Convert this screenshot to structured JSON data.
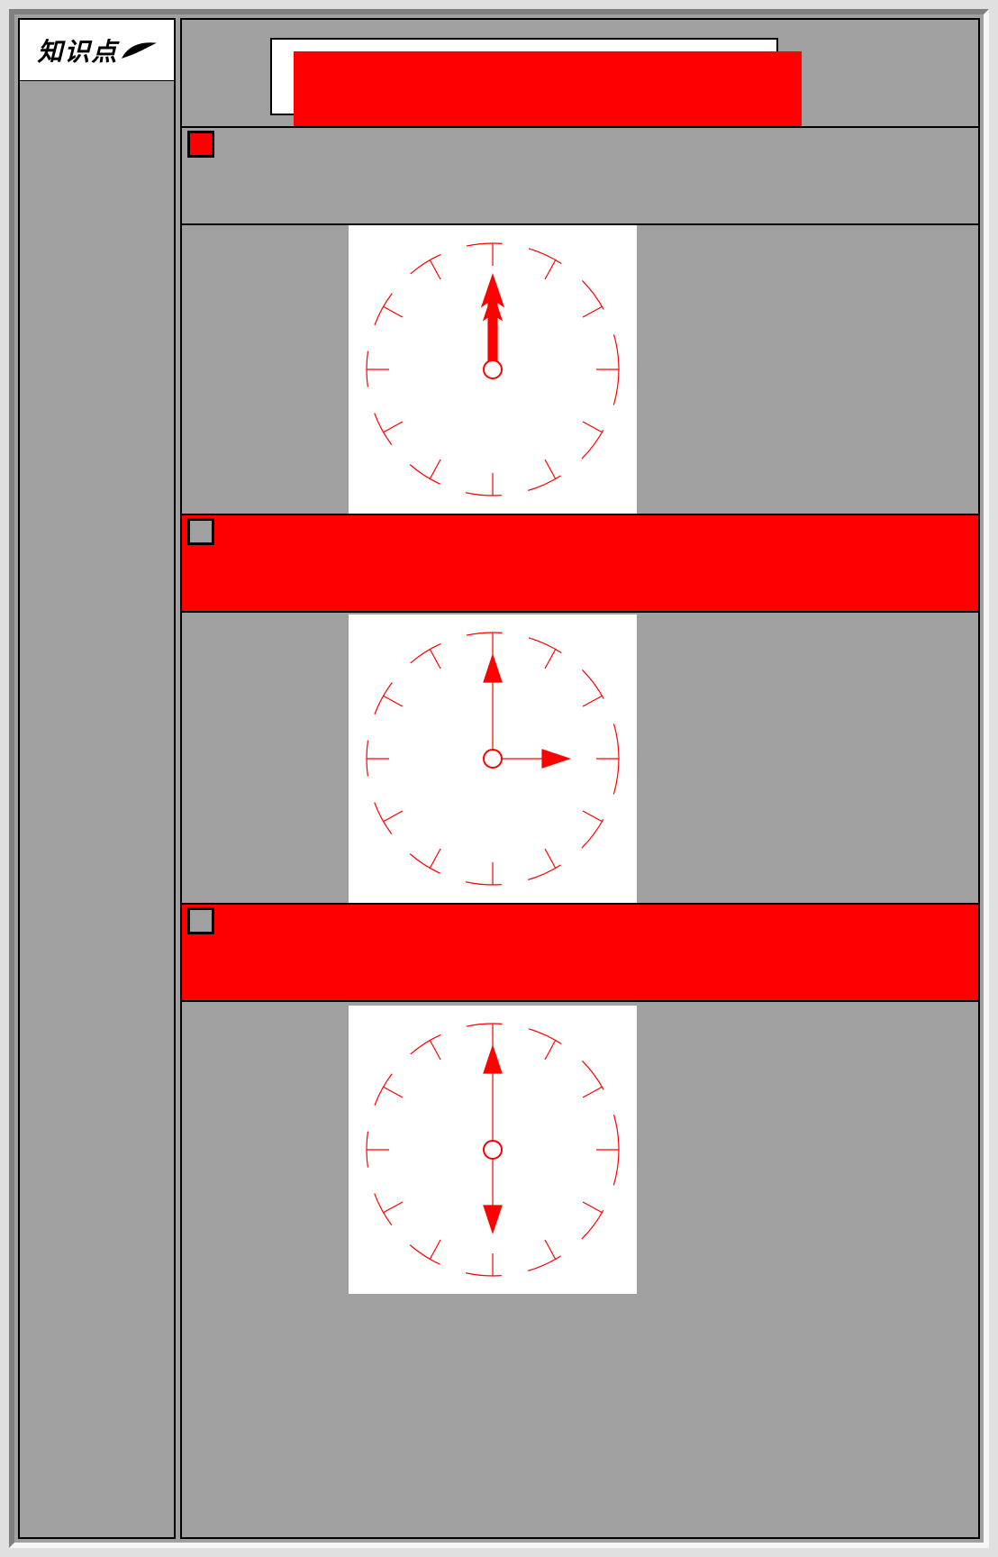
{
  "sidebar": {
    "header_text": "知识点"
  },
  "main": {
    "title": "",
    "sections": [
      {
        "label": "",
        "clock": {
          "hour": 12,
          "minute": 0
        }
      },
      {
        "label": "",
        "clock": {
          "hour": 3,
          "minute": 0
        }
      },
      {
        "label": "",
        "clock": {
          "hour": 6,
          "minute": 0
        }
      }
    ]
  },
  "colors": {
    "accent": "#ff0000",
    "panel": "#a0a0a0",
    "frame_light": "#f5f5f5",
    "frame_dark": "#808080"
  },
  "chart_data": [
    {
      "type": "clock",
      "hour_hand_angle": 0,
      "minute_hand_angle": 0,
      "description": "12:00"
    },
    {
      "type": "clock",
      "hour_hand_angle": 90,
      "minute_hand_angle": 0,
      "description": "3:00"
    },
    {
      "type": "clock",
      "hour_hand_angle": 180,
      "minute_hand_angle": 0,
      "description": "6:00"
    }
  ]
}
